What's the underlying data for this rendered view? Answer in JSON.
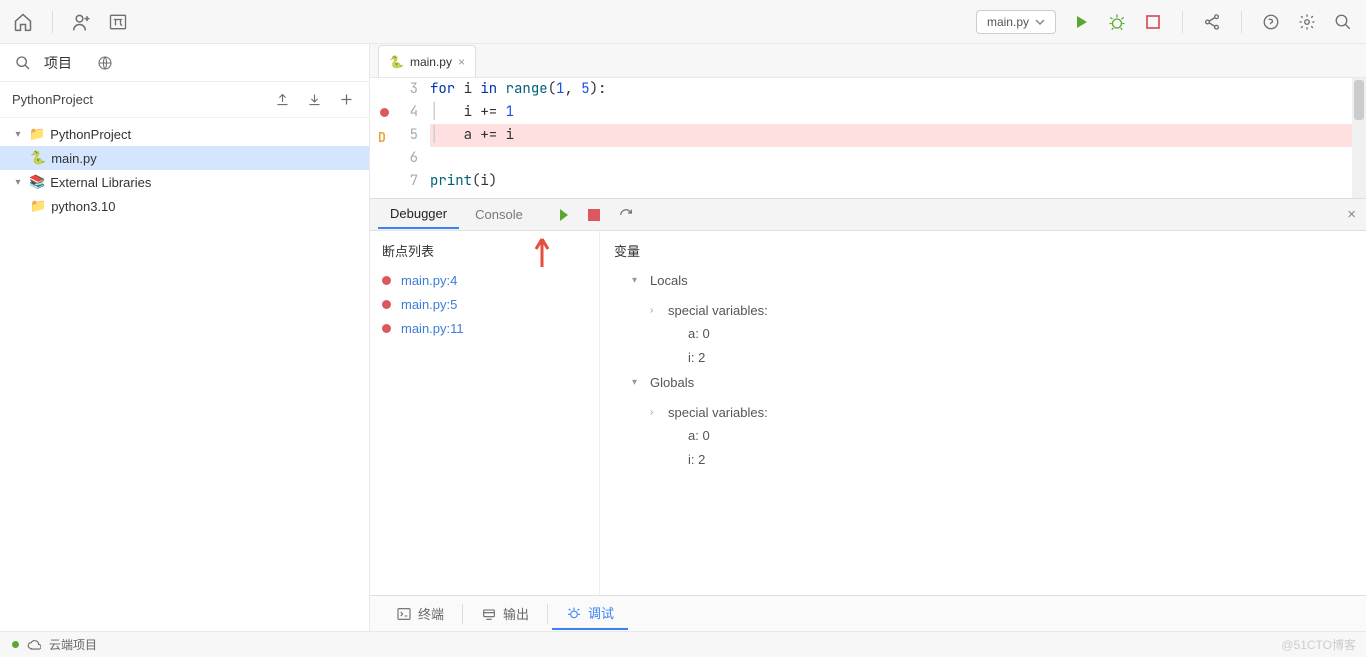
{
  "toolbar": {
    "run_config": "main.py"
  },
  "sidebar": {
    "title": "项目",
    "project_name": "PythonProject",
    "tree": {
      "root": "PythonProject",
      "file": "main.py",
      "ext_libs": "External Libraries",
      "python": "python3.10"
    }
  },
  "editor": {
    "tab": "main.py",
    "lines": [
      {
        "num": "3",
        "bp": false,
        "d": false,
        "hl": false,
        "tokens": [
          {
            "t": "for",
            "c": "kw"
          },
          {
            "t": " i ",
            "c": ""
          },
          {
            "t": "in",
            "c": "kw"
          },
          {
            "t": " ",
            "c": ""
          },
          {
            "t": "range",
            "c": "fn"
          },
          {
            "t": "(",
            "c": ""
          },
          {
            "t": "1",
            "c": "num"
          },
          {
            "t": ", ",
            "c": ""
          },
          {
            "t": "5",
            "c": "num"
          },
          {
            "t": "):",
            "c": ""
          }
        ],
        "indent": 0
      },
      {
        "num": "4",
        "bp": true,
        "d": false,
        "hl": false,
        "tokens": [
          {
            "t": "i += ",
            "c": ""
          },
          {
            "t": "1",
            "c": "num"
          }
        ],
        "indent": 1
      },
      {
        "num": "5",
        "bp": false,
        "d": true,
        "hl": true,
        "tokens": [
          {
            "t": "a += i",
            "c": ""
          }
        ],
        "indent": 1
      },
      {
        "num": "6",
        "bp": false,
        "d": false,
        "hl": false,
        "tokens": [],
        "indent": 0
      },
      {
        "num": "7",
        "bp": false,
        "d": false,
        "hl": false,
        "tokens": [
          {
            "t": "print",
            "c": "fn"
          },
          {
            "t": "(i)",
            "c": ""
          }
        ],
        "indent": 0
      }
    ]
  },
  "debug": {
    "tabs": {
      "debugger": "Debugger",
      "console": "Console"
    },
    "bp_title": "断点列表",
    "breakpoints": [
      "main.py:4",
      "main.py:5",
      "main.py:11"
    ],
    "var_title": "变量",
    "locals_label": "Locals",
    "globals_label": "Globals",
    "special_label": "special variables:",
    "vars": {
      "a": "a: 0",
      "i": "i: 2"
    }
  },
  "bottom": {
    "terminal": "终端",
    "output": "输出",
    "debug": "调试"
  },
  "status": {
    "cloud": "云端项目",
    "watermark": "@51CTO博客"
  }
}
